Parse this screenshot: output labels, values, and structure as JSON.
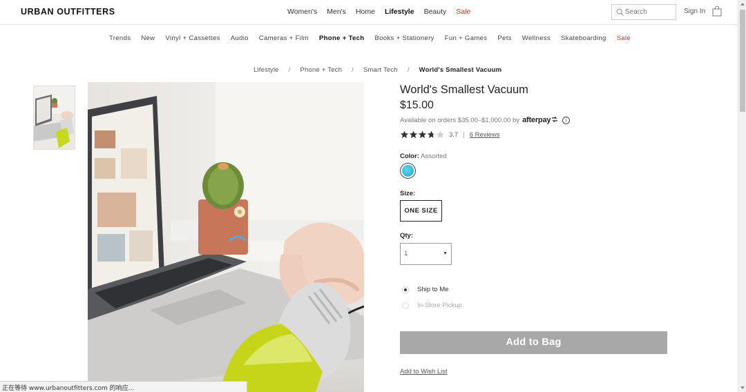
{
  "header": {
    "logo": "URBAN OUTFITTERS",
    "main_nav": [
      {
        "label": "Women's",
        "style": "normal"
      },
      {
        "label": "Men's",
        "style": "normal"
      },
      {
        "label": "Home",
        "style": "normal"
      },
      {
        "label": "Lifestyle",
        "style": "bold"
      },
      {
        "label": "Beauty",
        "style": "normal"
      },
      {
        "label": "Sale",
        "style": "sale"
      }
    ],
    "search_placeholder": "Search",
    "sign_in": "Sign In"
  },
  "sub_nav": [
    {
      "label": "Trends",
      "style": "normal"
    },
    {
      "label": "New",
      "style": "normal"
    },
    {
      "label": "Vinyl + Cassettes",
      "style": "normal"
    },
    {
      "label": "Audio",
      "style": "normal"
    },
    {
      "label": "Cameras + Film",
      "style": "normal"
    },
    {
      "label": "Phone + Tech",
      "style": "bold"
    },
    {
      "label": "Books + Stationery",
      "style": "normal"
    },
    {
      "label": "Fun + Games",
      "style": "normal"
    },
    {
      "label": "Pets",
      "style": "normal"
    },
    {
      "label": "Wellness",
      "style": "normal"
    },
    {
      "label": "Skateboarding",
      "style": "normal"
    },
    {
      "label": "Sale",
      "style": "sale"
    }
  ],
  "breadcrumb": {
    "items": [
      "Lifestyle",
      "Phone + Tech",
      "Smart Tech"
    ],
    "separator": "/",
    "current": "World's Smallest Vacuum"
  },
  "product": {
    "title": "World's Smallest Vacuum",
    "price": "$15.00",
    "afterpay_text": "Available on orders $35.00–$1,000.00 by",
    "afterpay_brand": "afterpay",
    "afterpay_info_symbol": "i",
    "rating_value": 3.7,
    "rating_text": "3.7",
    "rating_separator": "|",
    "reviews": "6 Reviews",
    "color_label": "Color:",
    "color_value": "Assorted",
    "swatch_color": "#2bb9dc",
    "size_label": "Size:",
    "size_option": "ONE SIZE",
    "qty_label": "Qty:",
    "qty_value": "1",
    "qty_arrow": "▼",
    "shipping_options": [
      {
        "label": "Ship to Me",
        "selected": true
      },
      {
        "label": "In-Store Pickup",
        "selected": false
      }
    ],
    "add_to_bag": "Add to Bag",
    "wish_list": "Add to Wish List"
  },
  "colors": {
    "sale": "#c0392b",
    "add_to_bag_bg": "#a8a8a8"
  },
  "status_bar": "正在等待 www.urbanoutfitters.com 的响应..."
}
